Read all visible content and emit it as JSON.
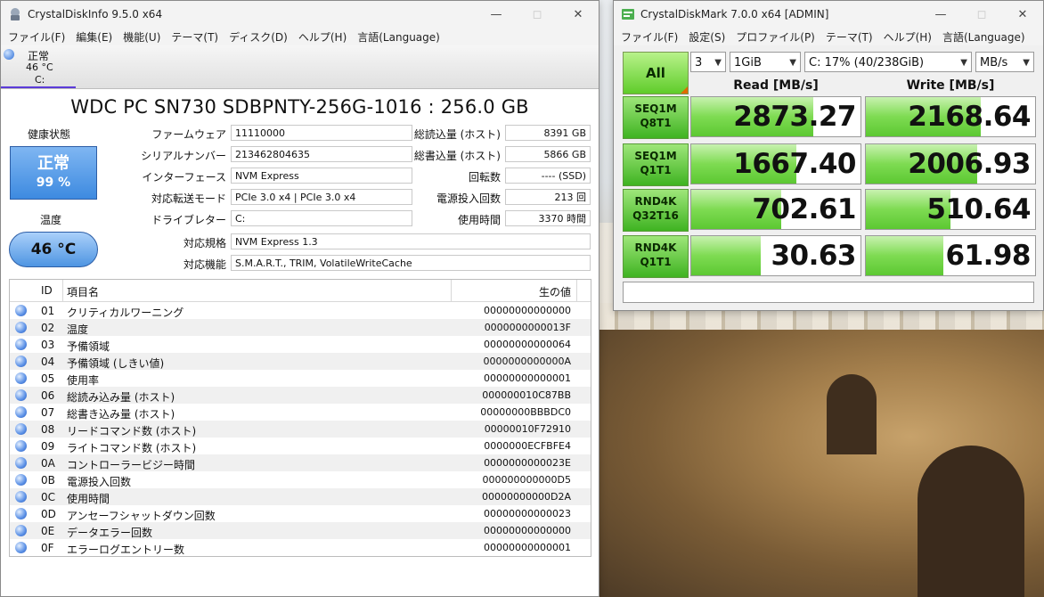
{
  "cdi": {
    "title": "CrystalDiskInfo 9.5.0 x64",
    "menu": [
      "ファイル(F)",
      "編集(E)",
      "機能(U)",
      "テーマ(T)",
      "ディスク(D)",
      "ヘルプ(H)",
      "言語(Language)"
    ],
    "drive_tab": {
      "status": "正常",
      "temp": "46 °C",
      "letter": "C:"
    },
    "model": "WDC PC SN730 SDBPNTY-256G-1016 : 256.0 GB",
    "health_label": "健康状態",
    "health_status": "正常",
    "health_percent": "99 %",
    "temp_label": "温度",
    "temp_value": "46 °C",
    "labels": {
      "firmware": "ファームウェア",
      "serial": "シリアルナンバー",
      "interface": "インターフェース",
      "transfer": "対応転送モード",
      "drive_letter": "ドライブレター",
      "standard": "対応規格",
      "features": "対応機能",
      "host_reads": "総読込量 (ホスト)",
      "host_writes": "総書込量 (ホスト)",
      "rotation": "回転数",
      "power_count": "電源投入回数",
      "power_hours": "使用時間"
    },
    "values": {
      "firmware": "11110000",
      "serial": "213462804635",
      "interface": "NVM Express",
      "transfer": "PCIe 3.0 x4 | PCIe 3.0 x4",
      "drive_letter": "C:",
      "standard": "NVM Express 1.3",
      "features": "S.M.A.R.T., TRIM, VolatileWriteCache",
      "host_reads": "8391 GB",
      "host_writes": "5866 GB",
      "rotation": "---- (SSD)",
      "power_count": "213 回",
      "power_hours": "3370 時間"
    },
    "smart_header": {
      "id": "ID",
      "name": "項目名",
      "raw": "生の値"
    },
    "smart_rows": [
      {
        "id": "01",
        "name": "クリティカルワーニング",
        "raw": "00000000000000"
      },
      {
        "id": "02",
        "name": "温度",
        "raw": "0000000000013F"
      },
      {
        "id": "03",
        "name": "予備領域",
        "raw": "00000000000064"
      },
      {
        "id": "04",
        "name": "予備領域 (しきい値)",
        "raw": "0000000000000A"
      },
      {
        "id": "05",
        "name": "使用率",
        "raw": "00000000000001"
      },
      {
        "id": "06",
        "name": "総読み込み量 (ホスト)",
        "raw": "000000010C87BB"
      },
      {
        "id": "07",
        "name": "総書き込み量 (ホスト)",
        "raw": "00000000BBBDC0"
      },
      {
        "id": "08",
        "name": "リードコマンド数 (ホスト)",
        "raw": "00000010F72910"
      },
      {
        "id": "09",
        "name": "ライトコマンド数 (ホスト)",
        "raw": "0000000ECFBFE4"
      },
      {
        "id": "0A",
        "name": "コントローラービジー時間",
        "raw": "0000000000023E"
      },
      {
        "id": "0B",
        "name": "電源投入回数",
        "raw": "000000000000D5"
      },
      {
        "id": "0C",
        "name": "使用時間",
        "raw": "00000000000D2A"
      },
      {
        "id": "0D",
        "name": "アンセーフシャットダウン回数",
        "raw": "00000000000023"
      },
      {
        "id": "0E",
        "name": "データエラー回数",
        "raw": "00000000000000"
      },
      {
        "id": "0F",
        "name": "エラーログエントリー数",
        "raw": "00000000000001"
      }
    ]
  },
  "cdm": {
    "title": "CrystalDiskMark 7.0.0 x64 [ADMIN]",
    "menu": [
      "ファイル(F)",
      "設定(S)",
      "プロファイル(P)",
      "テーマ(T)",
      "ヘルプ(H)",
      "言語(Language)"
    ],
    "all_label": "All",
    "count": "3",
    "size": "1GiB",
    "drive": "C: 17% (40/238GiB)",
    "unit": "MB/s",
    "read_header": "Read [MB/s]",
    "write_header": "Write [MB/s]",
    "tests": [
      {
        "l1": "SEQ1M",
        "l2": "Q8T1",
        "read": "2873.27",
        "write": "2168.64",
        "read_fill": 0.72,
        "write_fill": 0.68
      },
      {
        "l1": "SEQ1M",
        "l2": "Q1T1",
        "read": "1667.40",
        "write": "2006.93",
        "read_fill": 0.62,
        "write_fill": 0.66
      },
      {
        "l1": "RND4K",
        "l2": "Q32T16",
        "read": "702.61",
        "write": "510.64",
        "read_fill": 0.53,
        "write_fill": 0.5
      },
      {
        "l1": "RND4K",
        "l2": "Q1T1",
        "read": "30.63",
        "write": "61.98",
        "read_fill": 0.41,
        "write_fill": 0.46
      }
    ],
    "comment": ""
  }
}
